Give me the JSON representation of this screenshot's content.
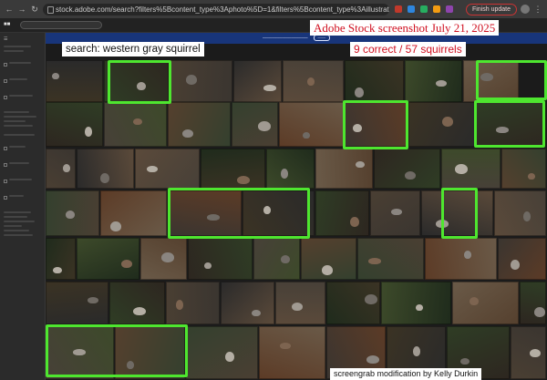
{
  "browser": {
    "url": "stock.adobe.com/search?filters%5Bcontent_type%3Aphoto%5D=1&filters%5Bcontent_type%3Aillustration%5D=0&filt...",
    "finish_update_label": "Finish update"
  },
  "overlay": {
    "screenshot_label": "Adobe Stock screenshot July 21, 2025",
    "search_label": "search: western gray squirrel",
    "count_label": "9 correct / 57 squirrels",
    "credit_label": "screengrab modification by Kelly Durkin"
  },
  "results": {
    "total_squirrels": 57,
    "correct": 9
  },
  "colors": {
    "highlight": "#4ee62f",
    "label_red": "#d01020",
    "banner": "#18357a"
  }
}
